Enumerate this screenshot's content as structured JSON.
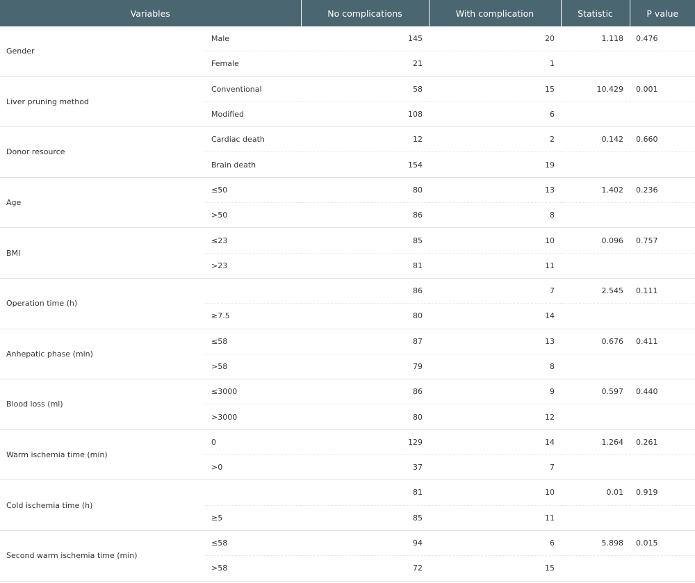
{
  "table": {
    "headers": [
      "Variables",
      "",
      "No complications",
      "With complication",
      "Statistic",
      "P value"
    ],
    "groups": [
      {
        "variable": "Gender",
        "rows": [
          {
            "category": "Male",
            "no": "145",
            "with": "20",
            "stat": "1.118",
            "p": "0.476"
          },
          {
            "category": "Female",
            "no": "21",
            "with": "1",
            "stat": "",
            "p": ""
          }
        ]
      },
      {
        "variable": "Liver pruning method",
        "rows": [
          {
            "category": "Conventional",
            "no": "58",
            "with": "15",
            "stat": "10.429",
            "p": "0.001"
          },
          {
            "category": "Modified",
            "no": "108",
            "with": "6",
            "stat": "",
            "p": ""
          }
        ]
      },
      {
        "variable": "Donor resource",
        "rows": [
          {
            "category": "Cardiac death",
            "no": "12",
            "with": "2",
            "stat": "0.142",
            "p": "0.660"
          },
          {
            "category": "Brain death",
            "no": "154",
            "with": "19",
            "stat": "",
            "p": ""
          }
        ]
      },
      {
        "variable": "Age",
        "rows": [
          {
            "category": "≤50",
            "no": "80",
            "with": "13",
            "stat": "1.402",
            "p": "0.236"
          },
          {
            "category": ">50",
            "no": "86",
            "with": "8",
            "stat": "",
            "p": ""
          }
        ]
      },
      {
        "variable": "BMI",
        "rows": [
          {
            "category": "≤23",
            "no": "85",
            "with": "10",
            "stat": "0.096",
            "p": "0.757"
          },
          {
            "category": ">23",
            "no": "81",
            "with": "11",
            "stat": "",
            "p": ""
          }
        ]
      },
      {
        "variable": "Operation time (h)",
        "rows": [
          {
            "category": "",
            "no": "86",
            "with": "7",
            "stat": "2.545",
            "p": "0.111"
          },
          {
            "category": "≥7.5",
            "no": "80",
            "with": "14",
            "stat": "",
            "p": ""
          }
        ]
      },
      {
        "variable": "Anhepatic phase (min)",
        "rows": [
          {
            "category": "≤58",
            "no": "87",
            "with": "13",
            "stat": "0.676",
            "p": "0.411"
          },
          {
            "category": ">58",
            "no": "79",
            "with": "8",
            "stat": "",
            "p": ""
          }
        ]
      },
      {
        "variable": "Blood loss (ml)",
        "rows": [
          {
            "category": "≤3000",
            "no": "86",
            "with": "9",
            "stat": "0.597",
            "p": "0.440"
          },
          {
            "category": ">3000",
            "no": "80",
            "with": "12",
            "stat": "",
            "p": ""
          }
        ]
      },
      {
        "variable": "Warm ischemia time (min)",
        "rows": [
          {
            "category": "0",
            "no": "129",
            "with": "14",
            "stat": "1.264",
            "p": "0.261"
          },
          {
            "category": ">0",
            "no": "37",
            "with": "7",
            "stat": "",
            "p": ""
          }
        ]
      },
      {
        "variable": "Cold ischemia time (h)",
        "rows": [
          {
            "category": "",
            "no": "81",
            "with": "10",
            "stat": "0.01",
            "p": "0.919"
          },
          {
            "category": "≥5",
            "no": "85",
            "with": "11",
            "stat": "",
            "p": ""
          }
        ]
      },
      {
        "variable": "Second warm ischemia time (min)",
        "rows": [
          {
            "category": "≤58",
            "no": "94",
            "with": "6",
            "stat": "5.898",
            "p": "0.015"
          },
          {
            "category": ">58",
            "no": "72",
            "with": "15",
            "stat": "",
            "p": ""
          }
        ]
      }
    ]
  }
}
